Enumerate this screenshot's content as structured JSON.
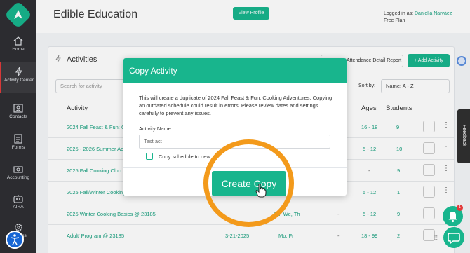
{
  "app_title": "Edible Education",
  "header": {
    "view_profile": "View Profile",
    "logged_in_prefix": "Logged in as:",
    "user_name": "Daniella Narváez",
    "plan": "Free Plan"
  },
  "sidebar": {
    "items": [
      {
        "label": "Home",
        "icon": "home-icon"
      },
      {
        "label": "Activity Center",
        "icon": "bolt-icon",
        "active": true
      },
      {
        "label": "Contacts",
        "icon": "contacts-icon"
      },
      {
        "label": "Forms",
        "icon": "forms-icon"
      },
      {
        "label": "Accounting",
        "icon": "accounting-icon"
      },
      {
        "label": "AIRA",
        "icon": "aira-icon"
      },
      {
        "label": "Settings",
        "icon": "gear-icon"
      }
    ]
  },
  "activities": {
    "title": "Activities",
    "attendance_btn": "Attendance Detail Report",
    "add_btn": "+ Add Activity",
    "search_placeholder": "Search for activity",
    "sort_label": "Sort by:",
    "sort_value": "Name: A - Z",
    "columns": {
      "activity": "Activity",
      "ages": "Ages",
      "students": "Students"
    },
    "rows": [
      {
        "name": "2024 Fall Feast & Fun: Co",
        "date": "",
        "days": "",
        "dash": "",
        "ages": "16 - 18",
        "students": "9"
      },
      {
        "name": "2025 - 2026 Summer Acti",
        "date": "",
        "days": "",
        "dash": "",
        "ages": "5 - 12",
        "students": "10"
      },
      {
        "name": "2025 Fall Cooking Club @",
        "date": "",
        "days": "",
        "dash": "",
        "ages": "-",
        "students": "9"
      },
      {
        "name": "2025 Fall/Winter Cooking",
        "date": "",
        "days": "",
        "dash": "",
        "ages": "5 - 12",
        "students": "1"
      },
      {
        "name": "2025 Winter Cooking Basics @ 23185",
        "date": "",
        "days": "Tu, We, Th",
        "dash": "-",
        "ages": "5 - 12",
        "students": "9"
      },
      {
        "name": "Adult' Program @ 23185",
        "date": "3-21-2025",
        "days": "Mo, Fr",
        "dash": "-",
        "ages": "18 - 99",
        "students": "2"
      }
    ]
  },
  "modal": {
    "title": "Copy Activity",
    "description": "This will create a duplicate of 2024 Fall Feast & Fun: Cooking Adventures. Copying an outdated schedule could result in errors. Please review dates and settings carefully to prevent any issues.",
    "field_label": "Activity Name",
    "field_value": "Test act",
    "checkbox_label": "Copy schedule to new",
    "create_button": "Create Copy"
  },
  "widgets": {
    "feedback": "Feedback",
    "bell_badge": "1"
  },
  "colors": {
    "brand": "#18b58d",
    "highlight": "#f39a1b",
    "sidebar": "#2f2f33"
  }
}
